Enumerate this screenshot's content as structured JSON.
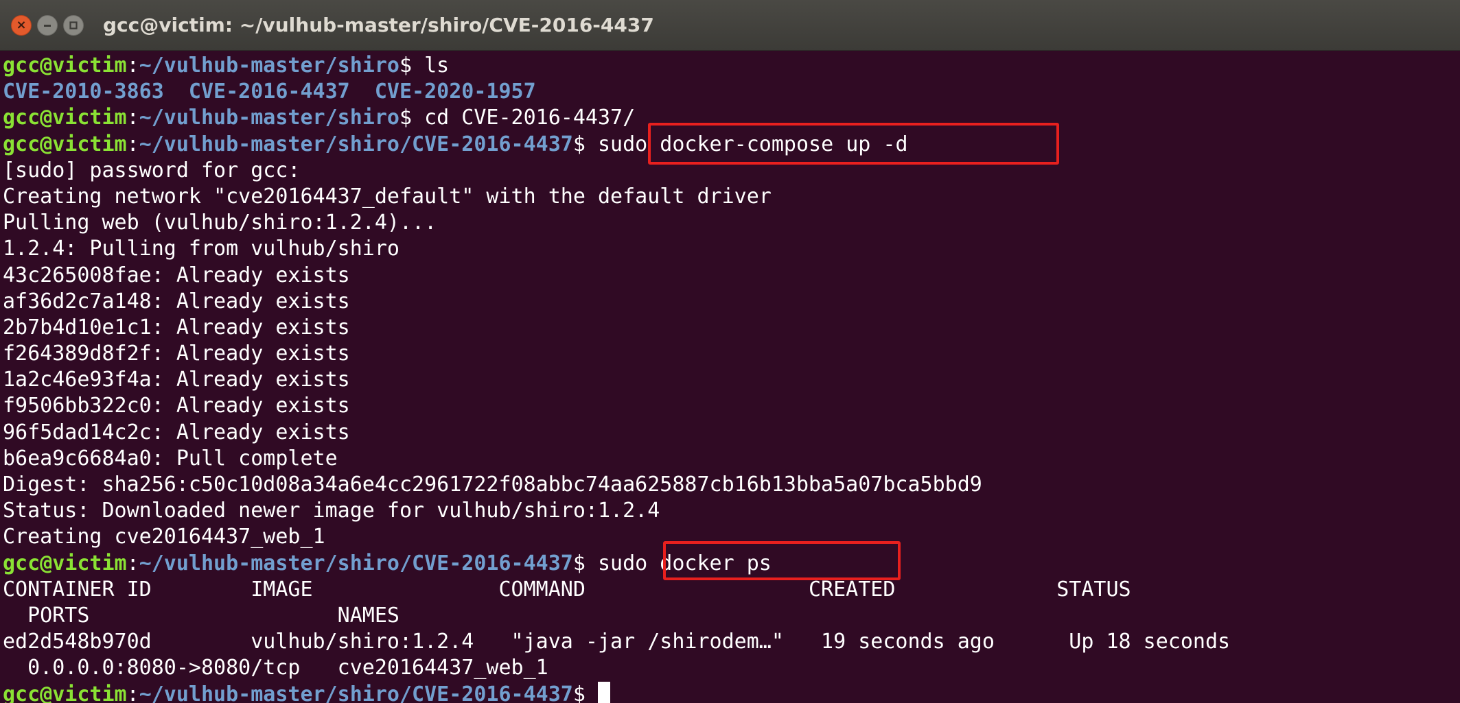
{
  "window": {
    "title": "gcc@victim: ~/vulhub-master/shiro/CVE-2016-4437",
    "close_symbol": "×",
    "minimize_icon": "minimize-icon",
    "maximize_icon": "maximize-icon"
  },
  "colors": {
    "background": "#300a24",
    "prompt_user": "#8ae234",
    "prompt_path": "#729fcf",
    "highlight_box": "#e8201e"
  },
  "terminal": {
    "prompt_user": "gcc@victim",
    "lines": [
      {
        "type": "prompt",
        "path": "~/vulhub-master/shiro",
        "cmd": " ls"
      },
      {
        "type": "dirs",
        "text": "CVE-2010-3863  CVE-2016-4437  CVE-2020-1957"
      },
      {
        "type": "prompt",
        "path": "~/vulhub-master/shiro",
        "cmd": " cd CVE-2016-4437/"
      },
      {
        "type": "prompt",
        "path": "~/vulhub-master/shiro/CVE-2016-4437",
        "cmd": " sudo docker-compose up -d"
      },
      {
        "type": "out",
        "text": "[sudo] password for gcc:"
      },
      {
        "type": "out",
        "text": "Creating network \"cve20164437_default\" with the default driver"
      },
      {
        "type": "out",
        "text": "Pulling web (vulhub/shiro:1.2.4)..."
      },
      {
        "type": "out",
        "text": "1.2.4: Pulling from vulhub/shiro"
      },
      {
        "type": "out",
        "text": "43c265008fae: Already exists"
      },
      {
        "type": "out",
        "text": "af36d2c7a148: Already exists"
      },
      {
        "type": "out",
        "text": "2b7b4d10e1c1: Already exists"
      },
      {
        "type": "out",
        "text": "f264389d8f2f: Already exists"
      },
      {
        "type": "out",
        "text": "1a2c46e93f4a: Already exists"
      },
      {
        "type": "out",
        "text": "f9506bb322c0: Already exists"
      },
      {
        "type": "out",
        "text": "96f5dad14c2c: Already exists"
      },
      {
        "type": "out",
        "text": "b6ea9c6684a0: Pull complete"
      },
      {
        "type": "out",
        "text": "Digest: sha256:c50c10d08a34a6e4cc2961722f08abbc74aa625887cb16b13bba5a07bca5bbd9"
      },
      {
        "type": "out",
        "text": "Status: Downloaded newer image for vulhub/shiro:1.2.4"
      },
      {
        "type": "out",
        "text": "Creating cve20164437_web_1"
      },
      {
        "type": "prompt",
        "path": "~/vulhub-master/shiro/CVE-2016-4437",
        "cmd": " sudo docker ps"
      },
      {
        "type": "out",
        "text": "CONTAINER ID        IMAGE               COMMAND                  CREATED             STATUS"
      },
      {
        "type": "out",
        "text": "  PORTS                    NAMES"
      },
      {
        "type": "out",
        "text": "ed2d548b970d        vulhub/shiro:1.2.4   \"java -jar /shirodem…\"   19 seconds ago      Up 18 seconds"
      },
      {
        "type": "out",
        "text": "  0.0.0.0:8080->8080/tcp   cve20164437_web_1"
      },
      {
        "type": "prompt_cursor",
        "path": "~/vulhub-master/shiro/CVE-2016-4437",
        "cmd": " "
      }
    ]
  }
}
